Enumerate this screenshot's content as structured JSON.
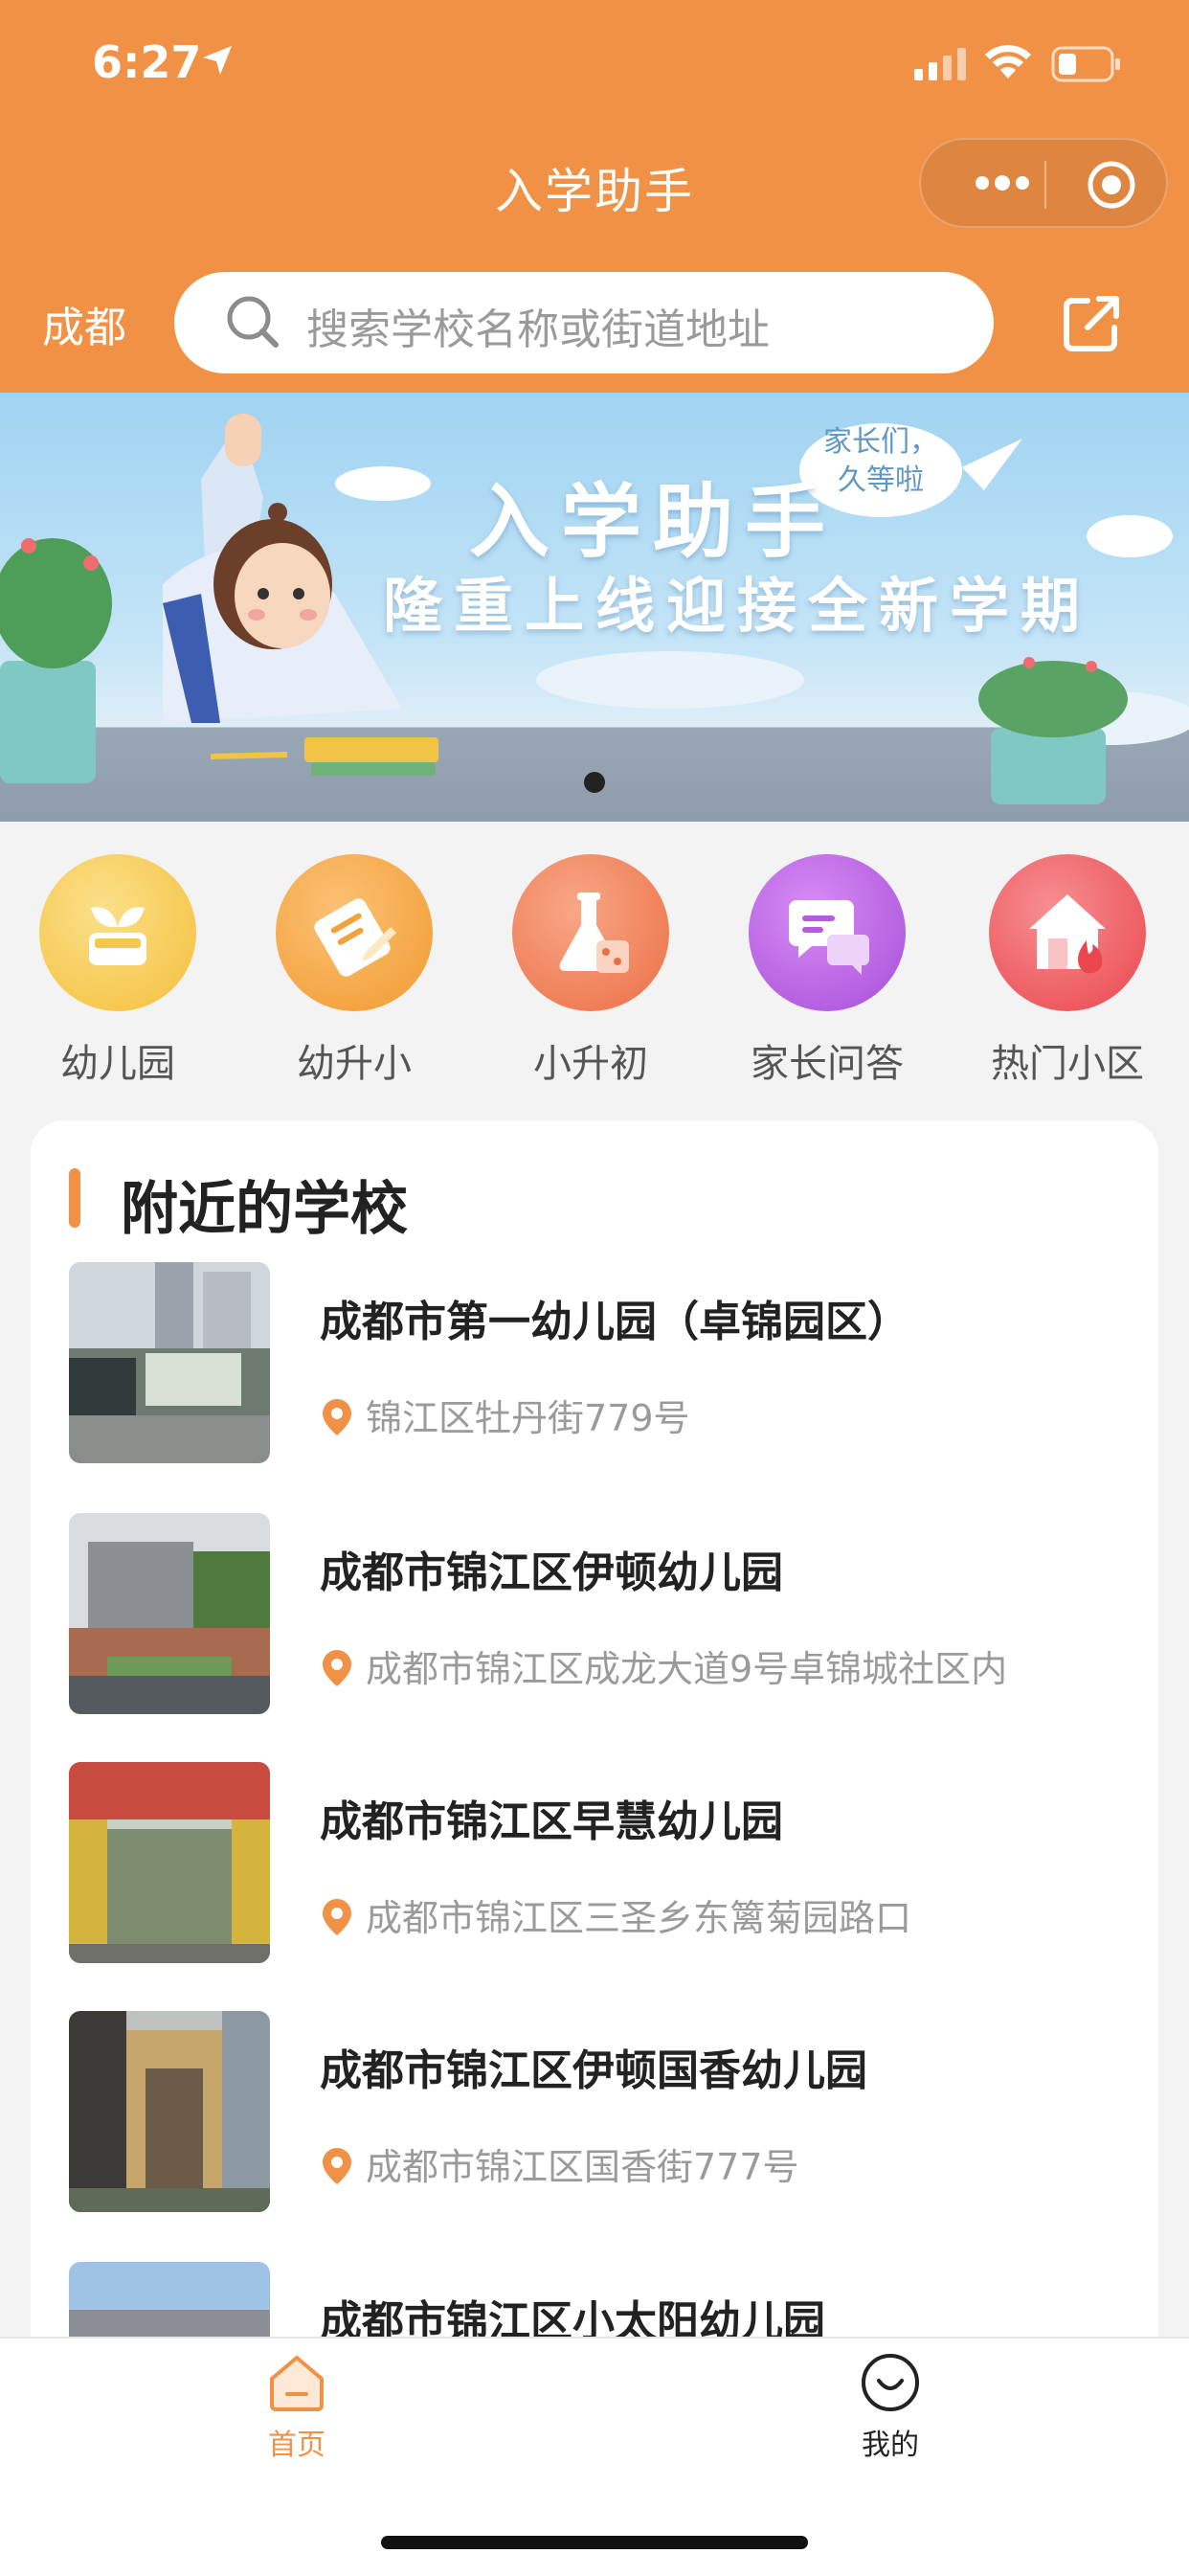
{
  "status": {
    "time": "6:27"
  },
  "nav": {
    "title": "入学助手"
  },
  "header": {
    "city": "成都",
    "search_placeholder": "搜索学校名称或街道地址"
  },
  "banner": {
    "title": "入学助手",
    "subtitle": "隆重上线迎接全新学期",
    "bubble_line1": "家长们，",
    "bubble_line2": "久等啦"
  },
  "categories": [
    {
      "label": "幼儿园",
      "icon": "sprout-pot-icon",
      "color": "#f6c342"
    },
    {
      "label": "幼升小",
      "icon": "pencil-icon",
      "color": "#f5a13a"
    },
    {
      "label": "小升初",
      "icon": "flask-icon",
      "color": "#ef7a4f"
    },
    {
      "label": "家长问答",
      "icon": "chat-bubbles-icon",
      "color": "#b45ce0"
    },
    {
      "label": "热门小区",
      "icon": "house-fire-icon",
      "color": "#ef5a5e"
    }
  ],
  "nearby": {
    "title": "附近的学校",
    "schools": [
      {
        "name": "成都市第一幼儿园（卓锦园区）",
        "address": "锦江区牡丹街779号"
      },
      {
        "name": "成都市锦江区伊顿幼儿园",
        "address": "成都市锦江区成龙大道9号卓锦城社区内"
      },
      {
        "name": "成都市锦江区早慧幼儿园",
        "address": "成都市锦江区三圣乡东篱菊园路口"
      },
      {
        "name": "成都市锦江区伊顿国香幼儿园",
        "address": "成都市锦江区国香街777号"
      },
      {
        "name": "成都市锦江区小太阳幼儿园",
        "address": ""
      }
    ]
  },
  "tabbar": {
    "home": "首页",
    "mine": "我的"
  },
  "colors": {
    "brand": "#f19146",
    "text": "#222222",
    "muted": "#9a9a9a"
  }
}
